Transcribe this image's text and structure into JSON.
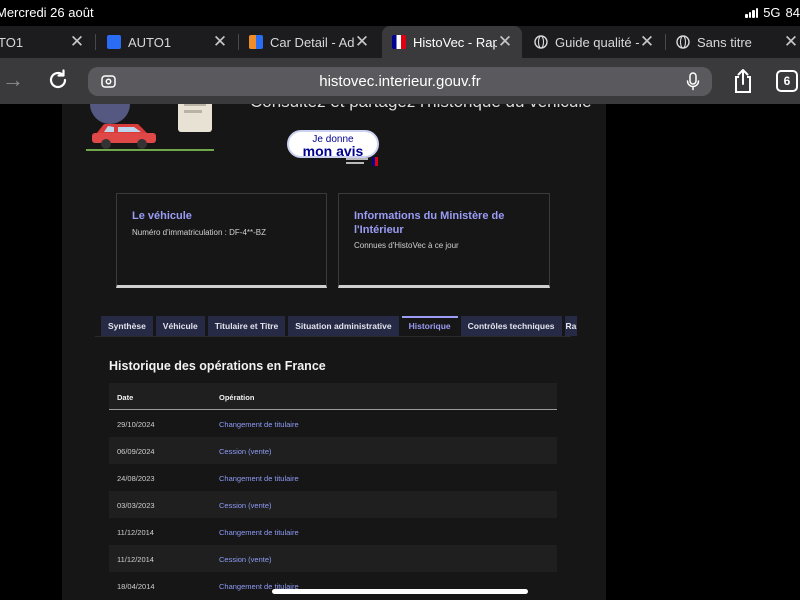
{
  "status_bar": {
    "time": "Mercredi 26 août",
    "network": "5G",
    "battery": "84"
  },
  "tabs": [
    {
      "title": "TO1",
      "icon": "none"
    },
    {
      "title": "AUTO1",
      "icon": "auto1-icon",
      "color": "#2a6df4"
    },
    {
      "title": "Car Detail - Ad",
      "icon": "car-detail-icon",
      "color": "#f28c28"
    },
    {
      "title": "HistoVec - Rap",
      "icon": "flag-fr-icon",
      "color": "#000091"
    },
    {
      "title": "Guide qualité -",
      "icon": "globe-icon"
    },
    {
      "title": "Sans titre",
      "icon": "globe-icon"
    }
  ],
  "address_bar": {
    "url": "histovec.interieur.gouv.fr",
    "tab_count": "6"
  },
  "hero": {
    "title": "Consultez et partagez l'historique du véhicule",
    "avis_line1": "Je donne",
    "avis_line2": "mon avis"
  },
  "cards": [
    {
      "title": "Le véhicule",
      "text": "Numéro d'immatriculation : DF-4**-BZ"
    },
    {
      "title_line1": "Informations du Ministère de",
      "title_line2": "l'Intérieur",
      "text": "Connues d'HistoVec à ce jour"
    }
  ],
  "site_tabs": [
    {
      "label": "Synthèse"
    },
    {
      "label": "Véhicule"
    },
    {
      "label": "Titulaire et Titre"
    },
    {
      "label": "Situation administrative"
    },
    {
      "label": "Historique"
    },
    {
      "label": "Contrôles techniques"
    },
    {
      "label": "Rap"
    }
  ],
  "history": {
    "title": "Historique des opérations en France",
    "columns": {
      "date": "Date",
      "operation": "Opération"
    },
    "rows": [
      {
        "date": "29/10/2024",
        "operation": "Changement de titulaire"
      },
      {
        "date": "06/09/2024",
        "operation": "Cession (vente)"
      },
      {
        "date": "24/08/2023",
        "operation": "Changement de titulaire"
      },
      {
        "date": "03/03/2023",
        "operation": "Cession (vente)"
      },
      {
        "date": "11/12/2014",
        "operation": "Changement de titulaire"
      },
      {
        "date": "11/12/2014",
        "operation": "Cession (vente)"
      },
      {
        "date": "18/04/2014",
        "operation": "Changement de titulaire"
      }
    ]
  },
  "colors": {
    "accent": "#9a9cf5",
    "link": "#8e9cf8",
    "tab_bg": "#262a44"
  }
}
